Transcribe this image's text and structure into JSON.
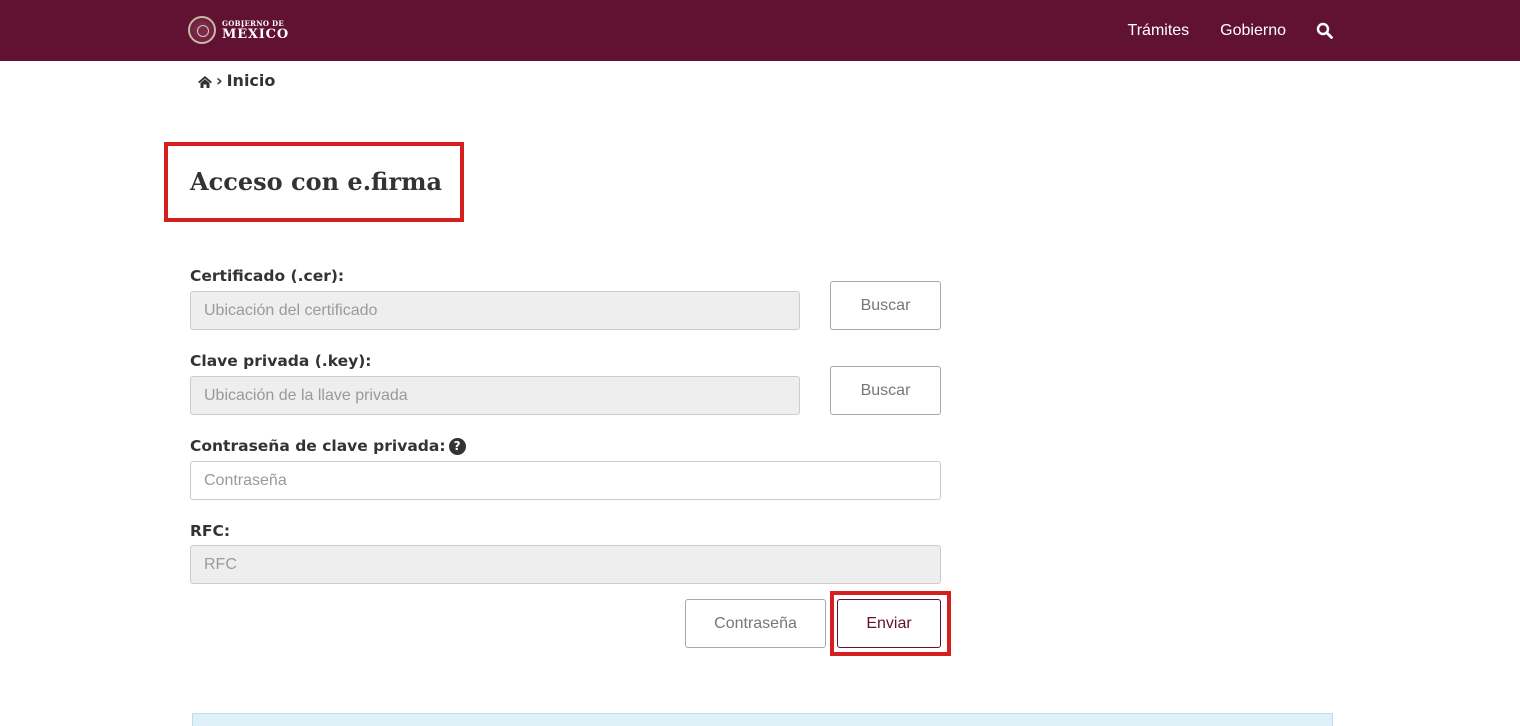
{
  "header": {
    "brand_top": "GOBIERNO DE",
    "brand_main": "MÉXICO",
    "nav_items": [
      {
        "label": "Trámites"
      },
      {
        "label": "Gobierno"
      }
    ],
    "color": "#611232"
  },
  "breadcrumb": {
    "separator": "›",
    "current": "Inicio"
  },
  "page": {
    "title": "Acceso con e.firma"
  },
  "form": {
    "certificate": {
      "label": "Certificado (.cer):",
      "placeholder": "Ubicación del certificado",
      "value": "",
      "browse_label": "Buscar"
    },
    "private_key": {
      "label": "Clave privada (.key):",
      "placeholder": "Ubicación de la llave privada",
      "value": "",
      "browse_label": "Buscar"
    },
    "password": {
      "label": "Contraseña de clave privada:",
      "help_glyph": "?",
      "placeholder": "Contraseña",
      "value": ""
    },
    "rfc": {
      "label": "RFC:",
      "placeholder": "RFC",
      "value": ""
    },
    "actions": {
      "password_login_label": "Contraseña",
      "submit_label": "Enviar"
    }
  },
  "annotation_color": "#d6201f"
}
